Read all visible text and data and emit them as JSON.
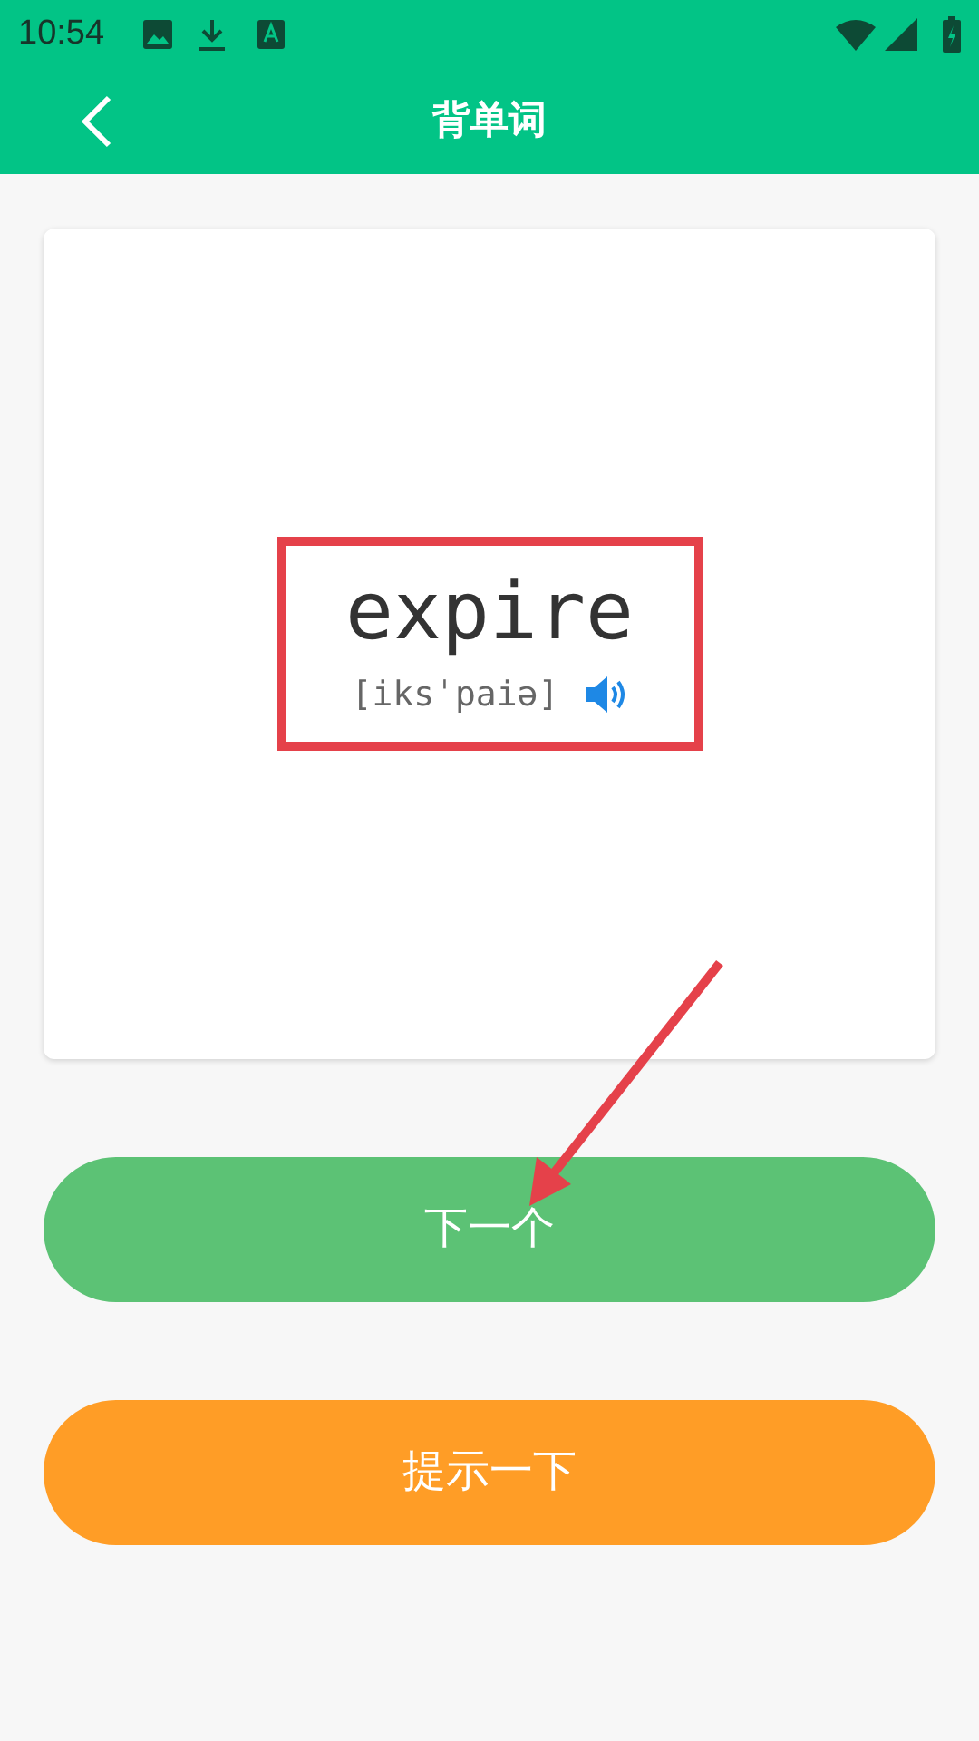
{
  "status_bar": {
    "time": "10:54"
  },
  "app_bar": {
    "title": "背单词"
  },
  "word_card": {
    "word": "expire",
    "phonetic": "[iksˈpaiə]"
  },
  "buttons": [
    {
      "label": "下一个",
      "kind": "next"
    },
    {
      "label": "提示一下",
      "kind": "hint"
    }
  ]
}
